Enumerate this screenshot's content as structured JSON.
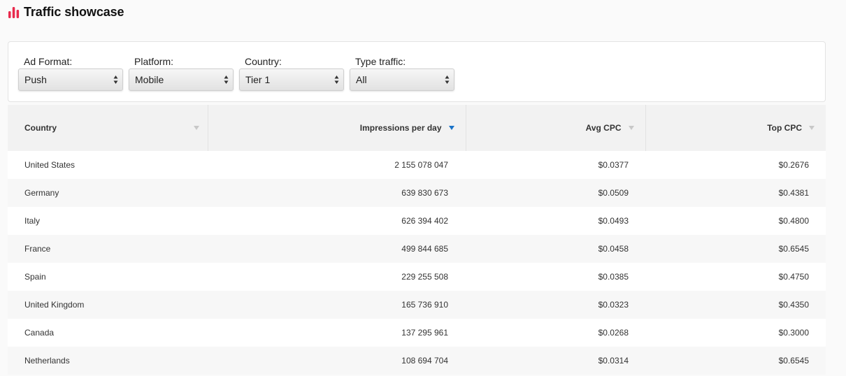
{
  "header": {
    "title": "Traffic showcase",
    "icon": "bar-chart-icon",
    "icon_color": "#e8294c"
  },
  "filters": [
    {
      "name": "ad-format",
      "label": "Ad Format:",
      "value": "Push"
    },
    {
      "name": "platform",
      "label": "Platform:",
      "value": "Mobile"
    },
    {
      "name": "country",
      "label": "Country:",
      "value": "Tier 1"
    },
    {
      "name": "type-traffic",
      "label": "Type traffic:",
      "value": "All"
    }
  ],
  "table": {
    "columns": [
      {
        "key": "country",
        "label": "Country",
        "sort": "none"
      },
      {
        "key": "impressions",
        "label": "Impressions per day",
        "sort": "desc"
      },
      {
        "key": "avg_cpc",
        "label": "Avg CPC",
        "sort": "none"
      },
      {
        "key": "top_cpc",
        "label": "Top CPC",
        "sort": "none"
      }
    ],
    "sort_active_color": "#1a73c8",
    "sort_inactive_color": "#c8c8c8",
    "rows": [
      {
        "country": "United States",
        "impressions": "2 155 078 047",
        "avg_cpc": "$0.0377",
        "top_cpc": "$0.2676"
      },
      {
        "country": "Germany",
        "impressions": "639 830 673",
        "avg_cpc": "$0.0509",
        "top_cpc": "$0.4381"
      },
      {
        "country": "Italy",
        "impressions": "626 394 402",
        "avg_cpc": "$0.0493",
        "top_cpc": "$0.4800"
      },
      {
        "country": "France",
        "impressions": "499 844 685",
        "avg_cpc": "$0.0458",
        "top_cpc": "$0.6545"
      },
      {
        "country": "Spain",
        "impressions": "229 255 508",
        "avg_cpc": "$0.0385",
        "top_cpc": "$0.4750"
      },
      {
        "country": "United Kingdom",
        "impressions": "165 736 910",
        "avg_cpc": "$0.0323",
        "top_cpc": "$0.4350"
      },
      {
        "country": "Canada",
        "impressions": "137 295 961",
        "avg_cpc": "$0.0268",
        "top_cpc": "$0.3000"
      },
      {
        "country": "Netherlands",
        "impressions": "108 694 704",
        "avg_cpc": "$0.0314",
        "top_cpc": "$0.6545"
      }
    ]
  }
}
